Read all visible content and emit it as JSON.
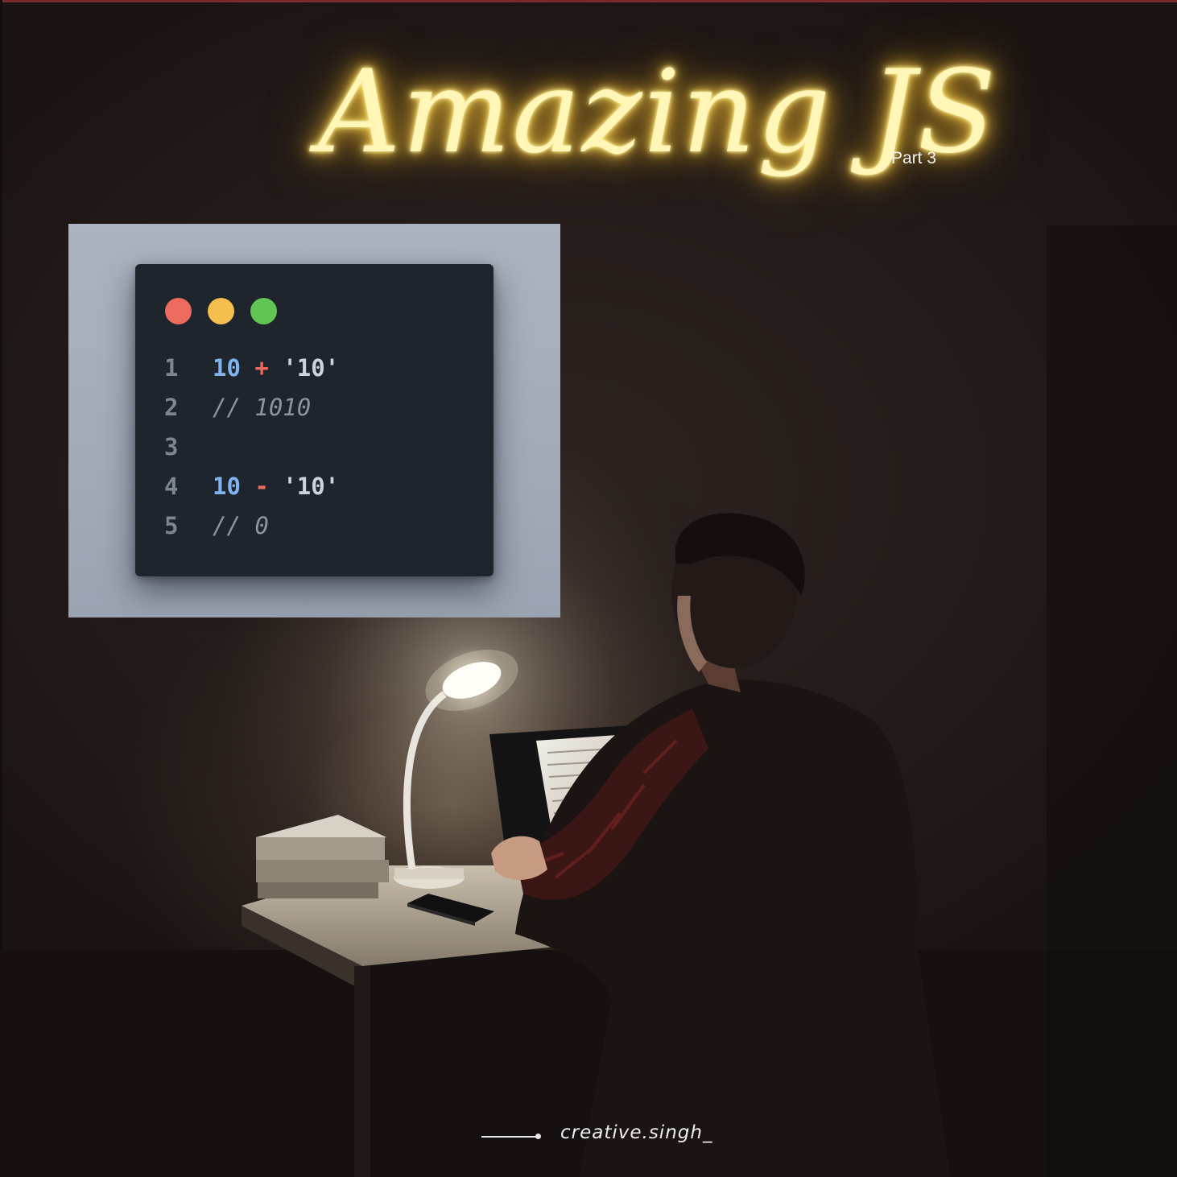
{
  "poster": {
    "title": "Amazing JS",
    "part_label": "Part 3",
    "handle": "creative.singh_"
  },
  "code_window": {
    "buttons": [
      "close",
      "minimize",
      "maximize"
    ],
    "lines": [
      {
        "number": "1",
        "left": "10",
        "op": "+",
        "right": "'10'",
        "comment": ""
      },
      {
        "number": "2",
        "left": "",
        "op": "",
        "right": "",
        "comment": "// 1010"
      },
      {
        "number": "3",
        "left": "",
        "op": "",
        "right": "",
        "comment": ""
      },
      {
        "number": "4",
        "left": "10",
        "op": "-",
        "right": "'10'",
        "comment": ""
      },
      {
        "number": "5",
        "left": "",
        "op": "",
        "right": "",
        "comment": "// 0"
      }
    ]
  },
  "colors": {
    "neon": "#ffe36a",
    "background": "#241c1a",
    "code_bg": "#1f252d",
    "card_bg": "#a2abb8"
  },
  "scene": {
    "description_icons": [
      "desk-lamp-icon",
      "laptop-icon",
      "phone-icon",
      "books-icon",
      "person-silhouette-icon"
    ]
  }
}
